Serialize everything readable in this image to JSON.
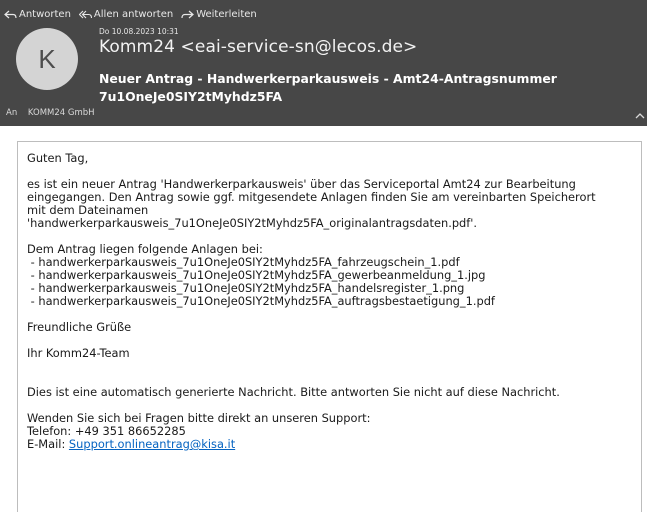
{
  "toolbar": {
    "reply": "Antworten",
    "reply_all": "Allen antworten",
    "forward": "Weiterleiten"
  },
  "message": {
    "date": "Do 10.08.2023 10:31",
    "avatar_initial": "K",
    "sender": "Komm24 <eai-service-sn@lecos.de>",
    "subject": "Neuer Antrag - Handwerkerparkausweis - Amt24-Antragsnummer 7u1OneJe0SIY2tMyhdz5FA",
    "to_label": "An",
    "to_value": "KOMM24 GmbH"
  },
  "body": {
    "greeting": "Guten Tag,",
    "para1_line1": "es ist ein neuer Antrag 'Handwerkerparkausweis' über das Serviceportal Amt24 zur Bearbeitung",
    "para1_line2": "eingegangen. Den Antrag sowie ggf. mitgesendete Anlagen finden Sie am vereinbarten Speicherort",
    "para1_line3": "mit dem Dateinamen",
    "para1_line4": "'handwerkerparkausweis_7u1OneJe0SIY2tMyhdz5FA_originalantragsdaten.pdf'.",
    "attachments_intro": "Dem Antrag liegen folgende Anlagen bei:",
    "attachments": [
      " - handwerkerparkausweis_7u1OneJe0SIY2tMyhdz5FA_fahrzeugschein_1.pdf",
      " - handwerkerparkausweis_7u1OneJe0SIY2tMyhdz5FA_gewerbeanmeldung_1.jpg",
      " - handwerkerparkausweis_7u1OneJe0SIY2tMyhdz5FA_handelsregister_1.png",
      " - handwerkerparkausweis_7u1OneJe0SIY2tMyhdz5FA_auftragsbestaetigung_1.pdf"
    ],
    "closing": "Freundliche Grüße",
    "signature": "Ihr Komm24-Team",
    "auto_notice": "Dies ist eine automatisch generierte Nachricht. Bitte antworten Sie nicht auf diese Nachricht.",
    "support_line": "Wenden Sie sich bei Fragen bitte direkt an unseren Support:",
    "phone_line": "Telefon: +49 351 86652285",
    "email_label": "E-Mail: ",
    "email_link": "Support.onlineantrag@kisa.it"
  },
  "colors": {
    "header_bg": "#474747",
    "link": "#0563c1"
  },
  "icons": [
    "reply-icon",
    "reply-all-icon",
    "forward-icon",
    "chevron-up-icon"
  ]
}
